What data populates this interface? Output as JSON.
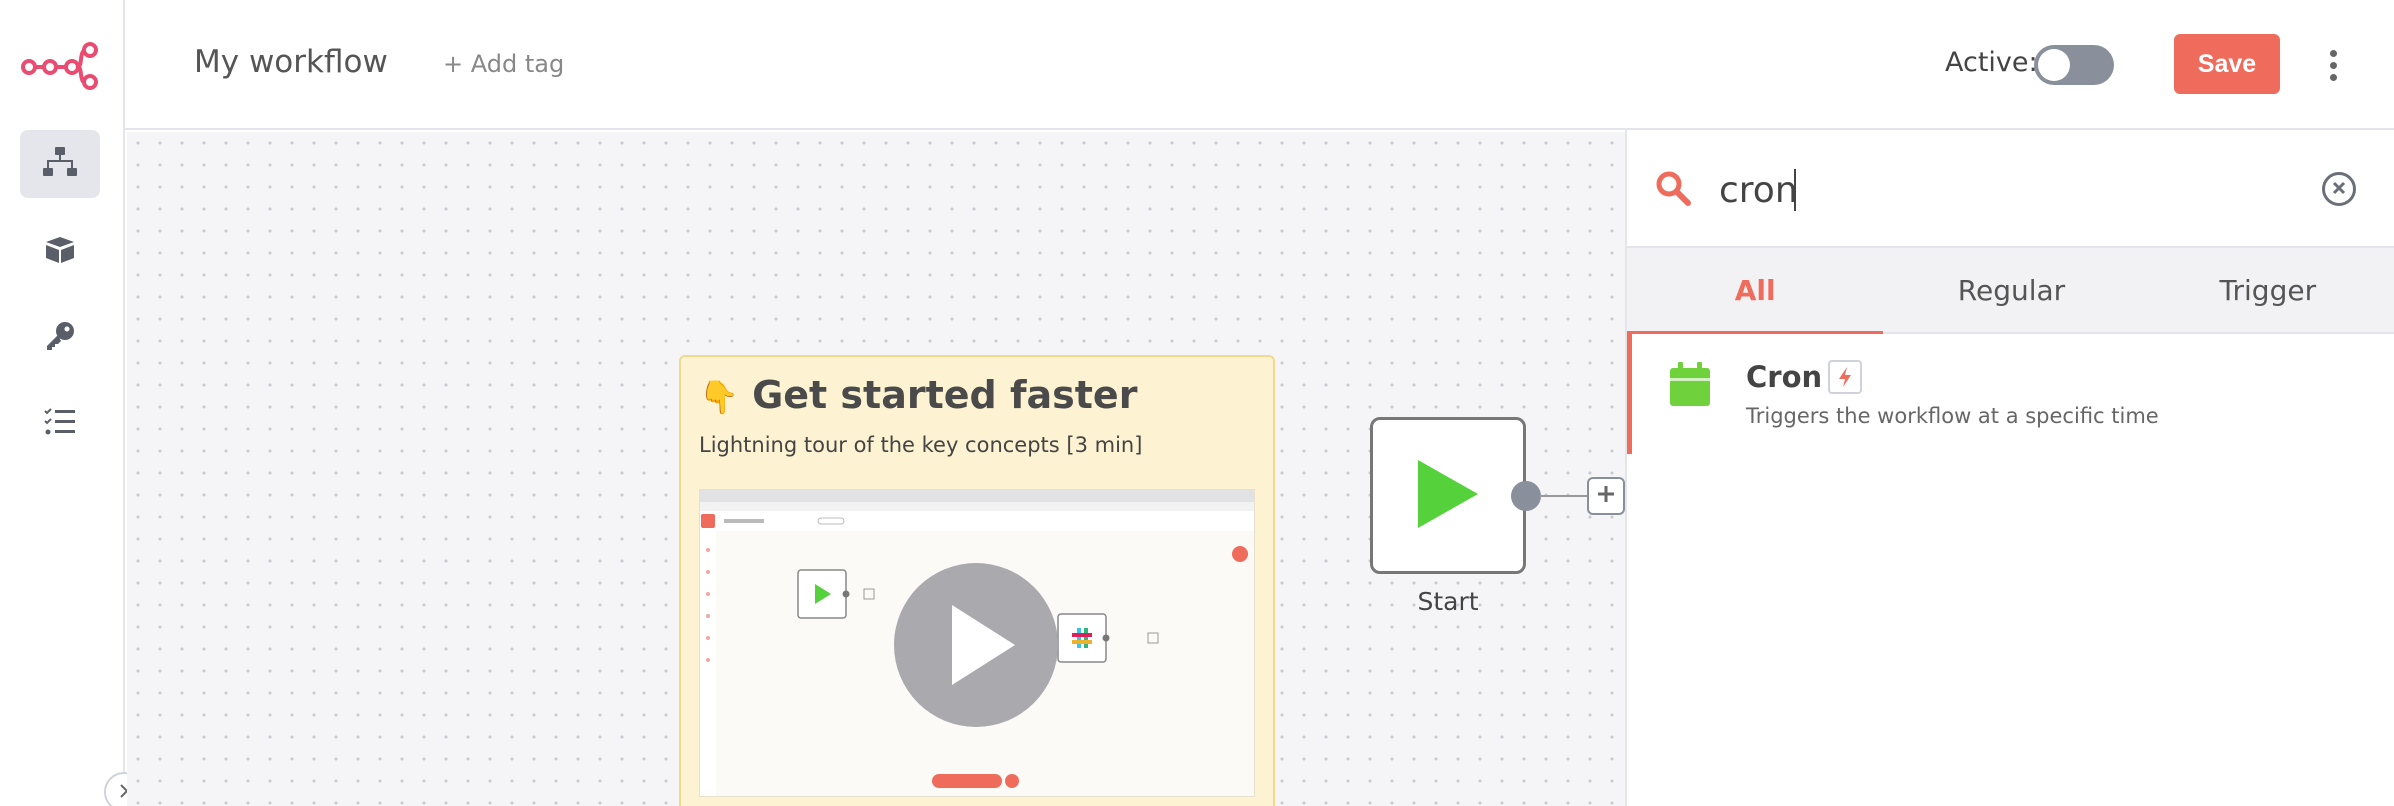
{
  "header": {
    "workflow_name": "My workflow",
    "add_tag_label": "+ Add tag",
    "active_label": "Active:",
    "active_state": false,
    "save_label": "Save"
  },
  "sidebar": {
    "items": [
      {
        "icon": "workflow-network-icon",
        "active": true
      },
      {
        "icon": "box-open-icon",
        "active": false
      },
      {
        "icon": "key-icon",
        "active": false
      },
      {
        "icon": "tasks-list-icon",
        "active": false
      }
    ]
  },
  "canvas": {
    "sticky": {
      "emoji": "👇",
      "title": "Get started faster",
      "subtitle": "Lightning tour of the key concepts [3 min]"
    },
    "start_node": {
      "label": "Start"
    }
  },
  "panel": {
    "search": {
      "value": "cron"
    },
    "tabs": [
      {
        "label": "All",
        "active": true
      },
      {
        "label": "Regular",
        "active": false
      },
      {
        "label": "Trigger",
        "active": false
      }
    ],
    "results": [
      {
        "name": "Cron",
        "description": "Triggers the workflow at a specific time",
        "icon": "calendar-icon",
        "badge": "trigger-bolt-icon"
      }
    ]
  },
  "colors": {
    "accent": "#ef6c5d",
    "node_green": "#55d13b",
    "sticky_bg": "#fdf3d3",
    "toggle_off": "#8a8f9c"
  }
}
